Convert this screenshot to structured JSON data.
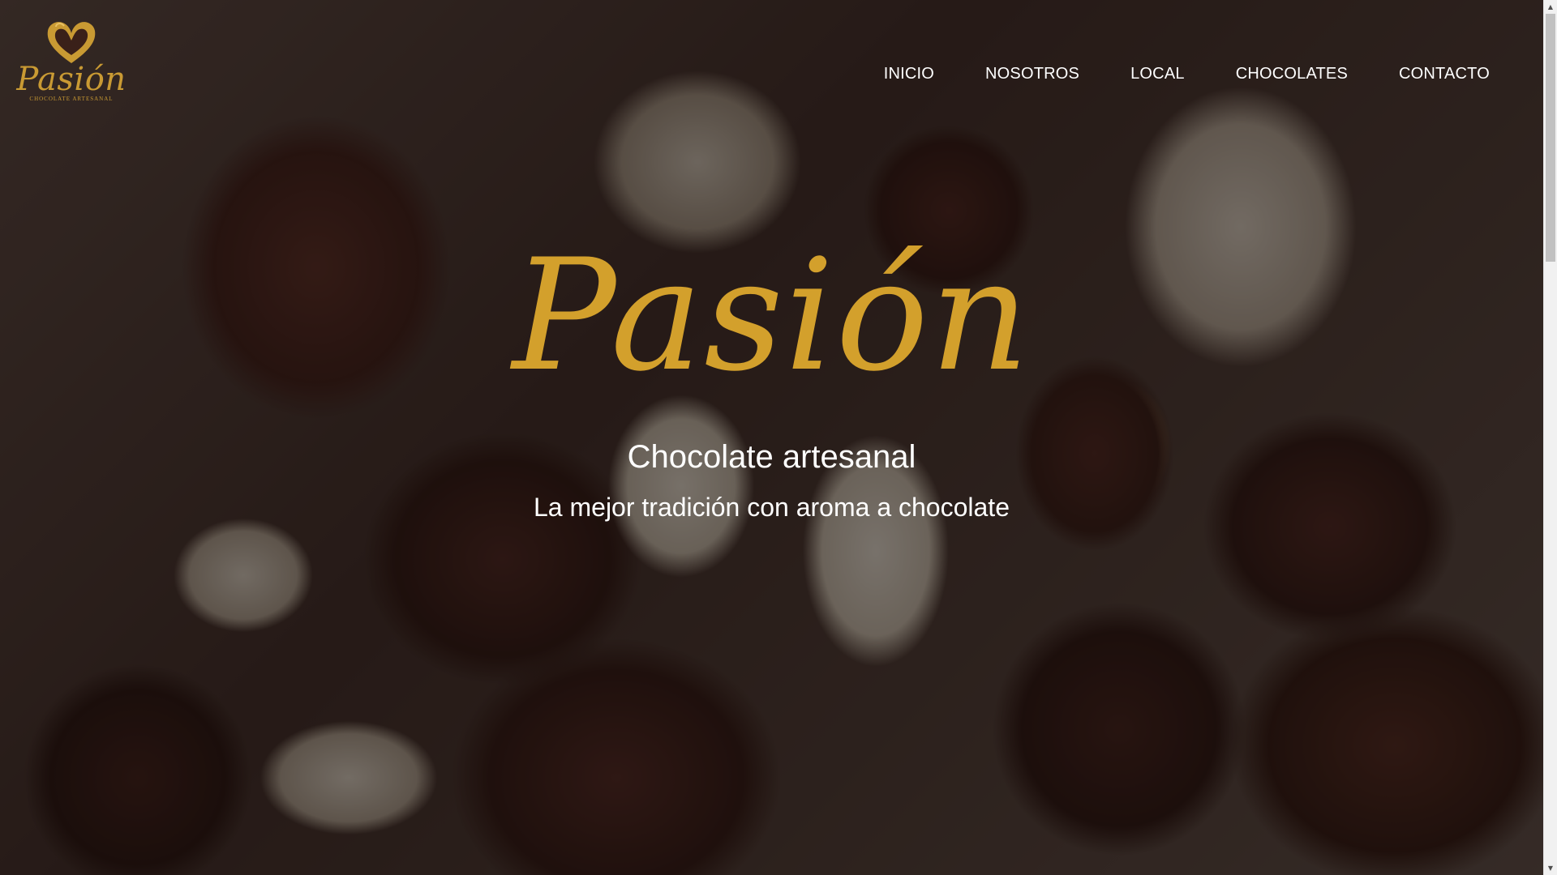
{
  "brand": {
    "logo_word": "Pasión",
    "logo_tagline": "CHOCOLATE ARTESANAL",
    "logo_icon": "heart-icon",
    "accent_color": "#d3a02c"
  },
  "nav": {
    "items": [
      {
        "label": "INICIO"
      },
      {
        "label": "NOSOTROS"
      },
      {
        "label": "LOCAL"
      },
      {
        "label": "CHOCOLATES"
      },
      {
        "label": "CONTACTO"
      }
    ]
  },
  "hero": {
    "title": "Pasión",
    "subtitle": "Chocolate artesanal",
    "tagline": "La mejor tradición con aroma a chocolate"
  },
  "scrollbar": {
    "up_icon": "triangle-up-icon",
    "down_icon": "triangle-down-icon"
  }
}
